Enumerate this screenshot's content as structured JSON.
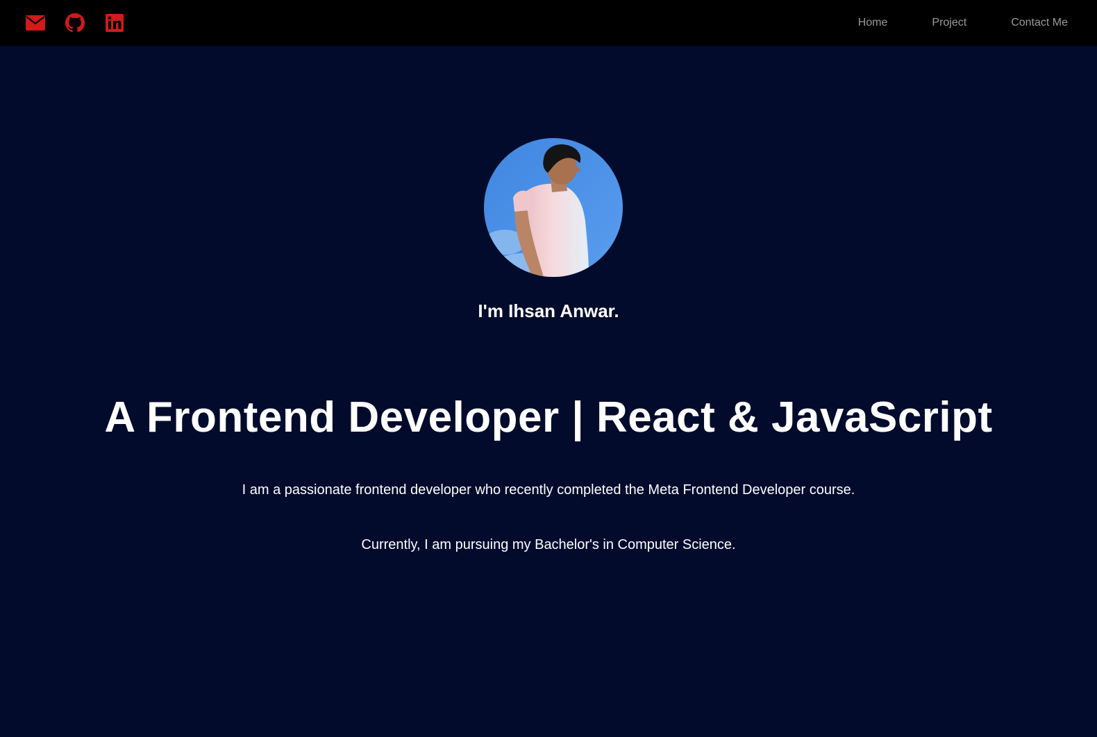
{
  "nav": {
    "social": [
      {
        "icon": "envelope-icon",
        "label": "email"
      },
      {
        "icon": "github-icon",
        "label": "github"
      },
      {
        "icon": "linkedin-icon",
        "label": "linkedin"
      }
    ],
    "icon_color": "#d11a1a",
    "links": [
      "Home",
      "Project",
      "Contact Me"
    ]
  },
  "hero": {
    "greeting": "I'm Ihsan Anwar.",
    "headline": "A Frontend Developer | React & JavaScript",
    "paragraph_1": "I am a passionate frontend developer who recently completed the Meta Frontend Developer course.",
    "paragraph_2": "Currently, I am pursuing my Bachelor's in Computer Science."
  },
  "colors": {
    "background": "#020b2c",
    "navbar": "#000000",
    "nav_text": "#9a9a9a",
    "hero_text": "#ffffff",
    "accent": "#d11a1a"
  }
}
